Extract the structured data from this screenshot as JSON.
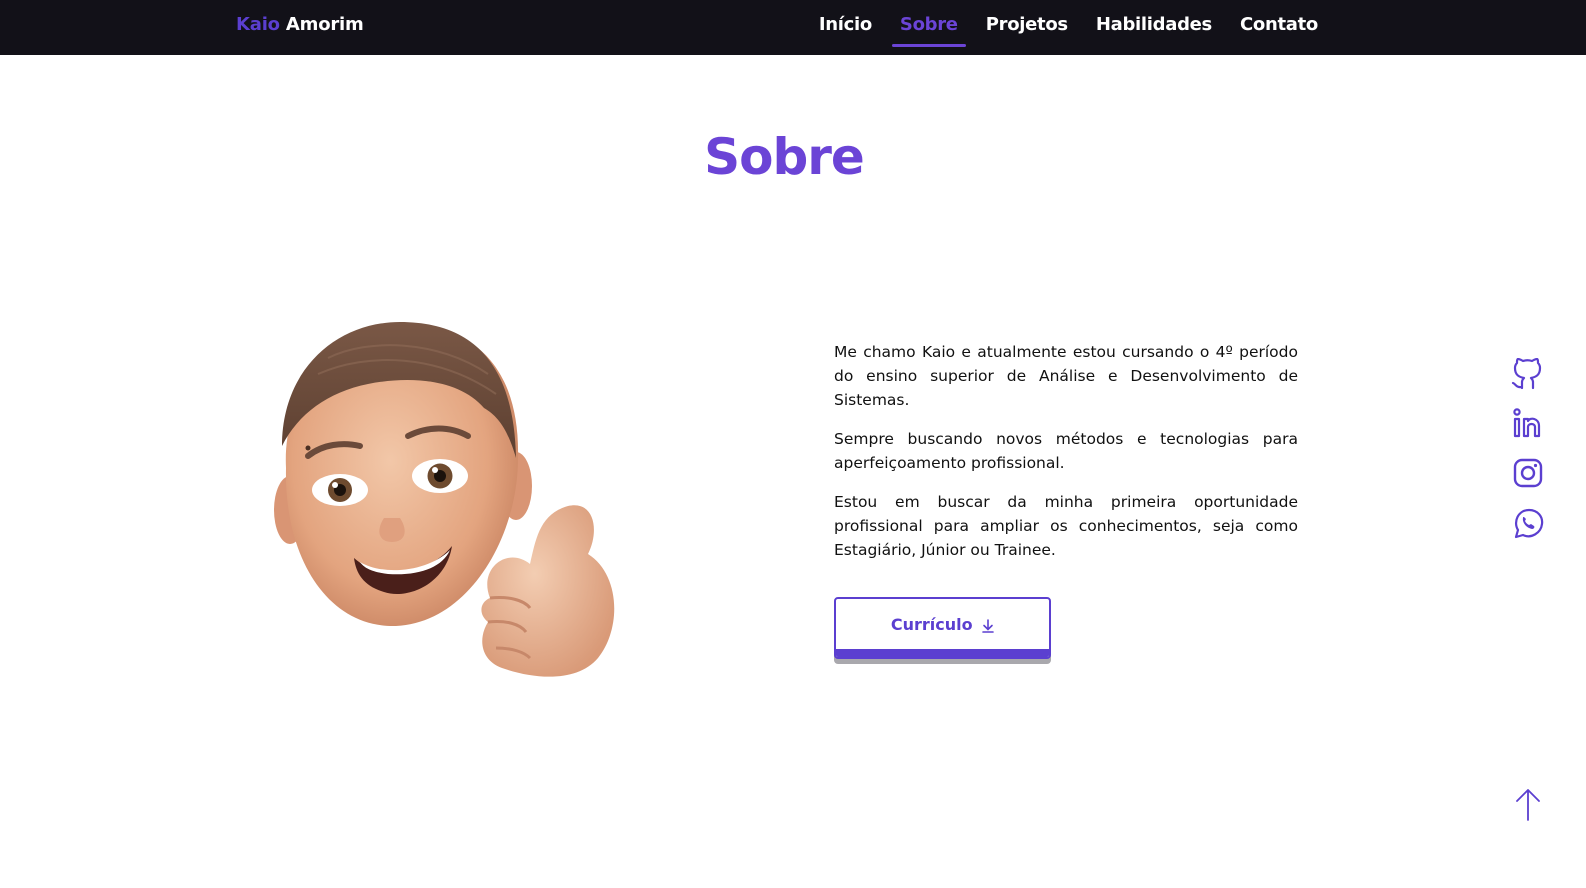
{
  "header": {
    "logo_first": "Kaio",
    "logo_last": "Amorim",
    "nav": [
      {
        "label": "Início"
      },
      {
        "label": "Sobre"
      },
      {
        "label": "Projetos"
      },
      {
        "label": "Habilidades"
      },
      {
        "label": "Contato"
      }
    ],
    "active": "Sobre"
  },
  "section": {
    "title": "Sobre",
    "paragraphs": [
      "Me chamo Kaio e atualmente estou cursando o 4º período do ensino superior de Análise e Desenvolvimento de Sistemas.",
      "Sempre buscando novos métodos e tecnologias para aperfeiçoamento profissional.",
      "Estou em buscar da minha primeira oportunidade profissional para ampliar os conhecimentos, seja como Estagiário, Júnior ou Trainee."
    ],
    "cv_button": "Currículo"
  },
  "social_icons": [
    "github-icon",
    "linkedin-icon",
    "instagram-icon",
    "whatsapp-icon"
  ],
  "colors": {
    "accent": "#6b44d6",
    "header_bg": "#121118"
  }
}
